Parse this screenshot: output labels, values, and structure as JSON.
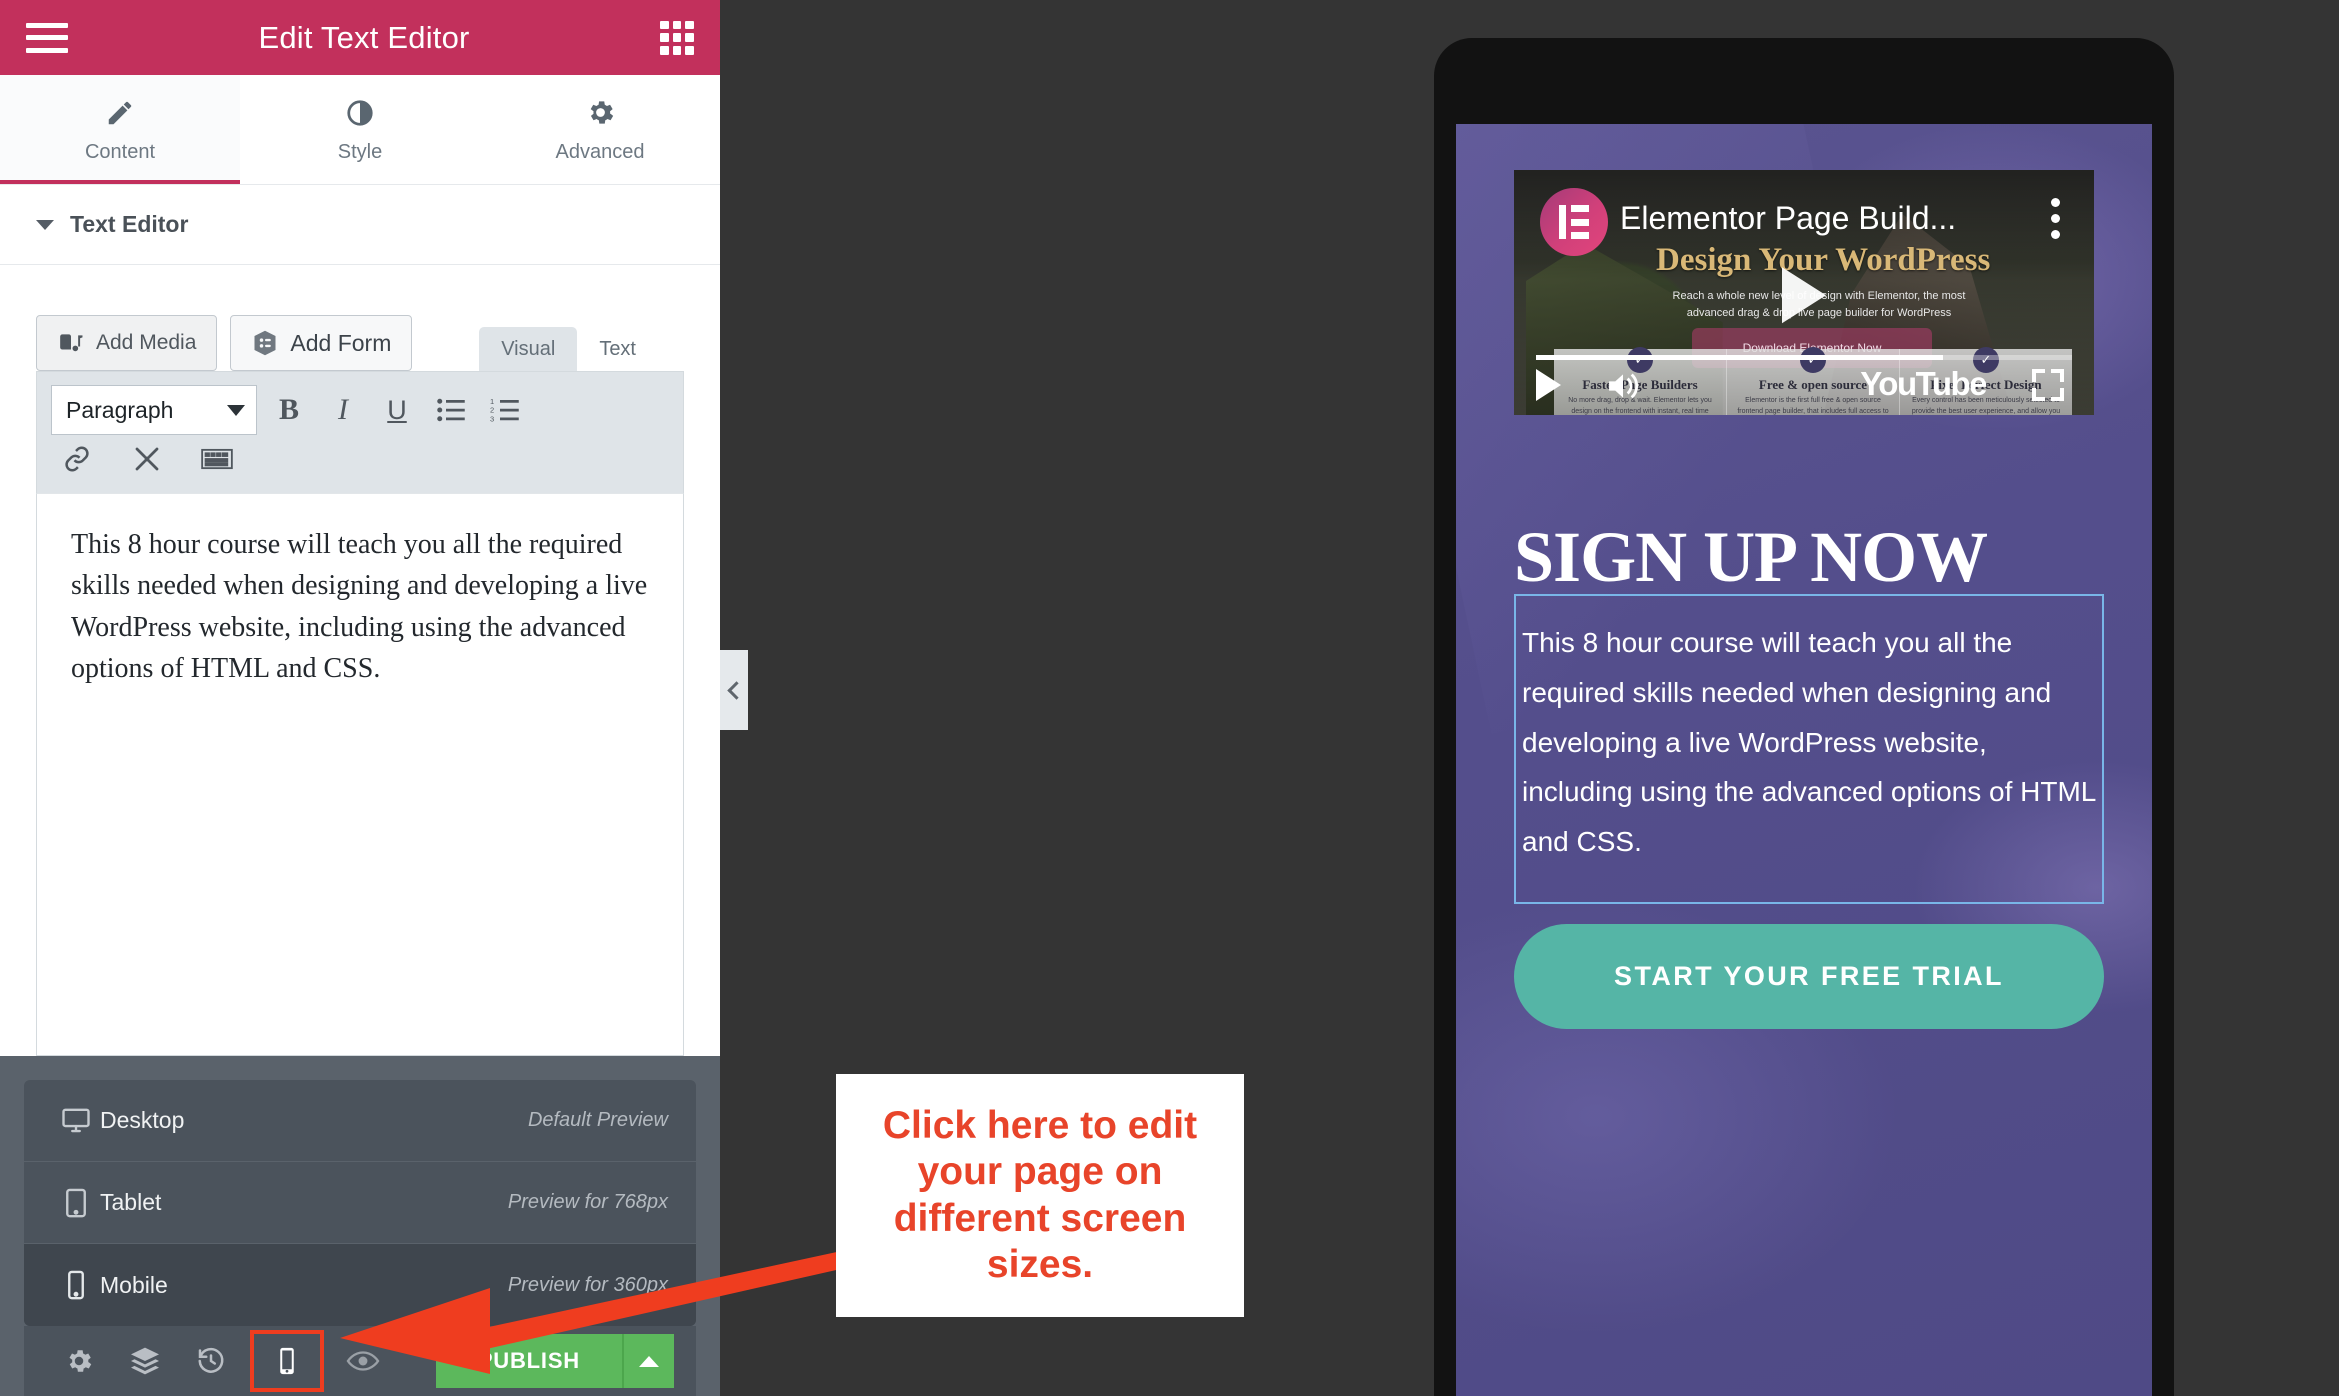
{
  "panel": {
    "header": {
      "title": "Edit Text Editor",
      "menu_icon": "hamburger-menu-icon",
      "grid_icon": "widgets-grid-icon"
    },
    "tabs": [
      {
        "label": "Content",
        "icon": "pencil-icon",
        "active": true
      },
      {
        "label": "Style",
        "icon": "contrast-circle-icon",
        "active": false
      },
      {
        "label": "Advanced",
        "icon": "gear-icon",
        "active": false
      }
    ],
    "section": {
      "title": "Text Editor",
      "toggle_icon": "caret-down-icon"
    },
    "editor": {
      "add_media_label": "Add Media",
      "add_form_label": "Add Form",
      "view_tabs": [
        {
          "label": "Visual",
          "active": true
        },
        {
          "label": "Text",
          "active": false
        }
      ],
      "format_select": "Paragraph",
      "toolbar_buttons": [
        "bold-icon",
        "italic-icon",
        "underline-icon",
        "bullet-list-icon",
        "numbered-list-icon",
        "link-icon",
        "fullscreen-icon",
        "keyboard-shortcuts-icon"
      ],
      "bold_label": "B",
      "italic_label": "I",
      "underline_label": "U",
      "content": "This 8 hour course will teach you all the required skills needed when designing and developing a live WordPress website, including using the advanced options of HTML and CSS."
    },
    "devices": [
      {
        "name": "Desktop",
        "note": "Default Preview",
        "icon": "desktop-icon",
        "active": false
      },
      {
        "name": "Tablet",
        "note": "Preview for 768px",
        "icon": "tablet-icon",
        "active": false
      },
      {
        "name": "Mobile",
        "note": "Preview for 360px",
        "icon": "mobile-icon",
        "active": true
      }
    ],
    "bottom_toolbar": {
      "icons": [
        "gear-icon",
        "layers-icon",
        "history-icon",
        "responsive-mode-icon",
        "preview-eye-icon"
      ],
      "publish_label": "PUBLISH",
      "publish_caret_icon": "caret-up-icon",
      "highlight_color": "#ef3d1f",
      "publish_color": "#5cb85c"
    },
    "collapse_handle_icon": "chevron-left-icon",
    "accent_color": "#c2305c"
  },
  "callout": {
    "text": "Click here to edit your page on different screen sizes.",
    "text_color": "#e8442a",
    "arrow_color": "#ef3d1f"
  },
  "preview": {
    "video": {
      "title": "Elementor Page Build...",
      "subtitle": "Design Your WordPress",
      "description": "Reach a whole new level of design with Elementor, the most advanced drag & drop live page builder for WordPress",
      "download_label": "Download Elementor Now",
      "play_icon": "play-icon",
      "menu_icon": "kebab-menu-icon",
      "volume_icon": "volume-icon",
      "fullscreen_icon": "fullscreen-icon",
      "brand_label": "YouTube",
      "features": [
        {
          "title": "Faster Page Builders",
          "body": "No more drag, drop & wait. Elementor lets you design on the frontend with instant, real time"
        },
        {
          "title": "Free & open source",
          "body": "Elementor is the first full free & open source frontend page builder, that includes full access to"
        },
        {
          "title": "Pixel Perfect Design",
          "body": "Every control has been meticulously selected to provide the best user experience, and allow you to"
        }
      ]
    },
    "heading": "SIGN UP NOW",
    "body": "This 8 hour course will teach you all the required skills needed when designing and developing a live WordPress website, including using the advanced options of HTML and CSS.",
    "cta_label": "START YOUR FREE TRIAL",
    "cta_color": "#55b5a6",
    "selection_border_color": "#79b6e8"
  }
}
